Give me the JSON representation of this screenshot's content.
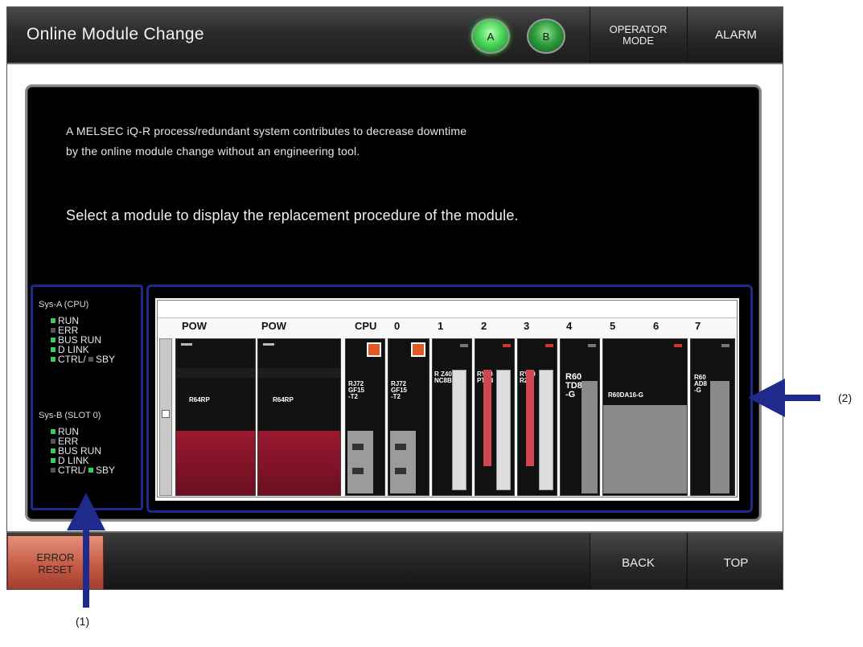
{
  "window": {
    "title": "Online Module Change",
    "lamp_a_label": "A",
    "lamp_b_label": "B",
    "operator_mode_label_line1": "OPERATOR",
    "operator_mode_label_line2": "MODE",
    "alarm_label": "ALARM"
  },
  "panel": {
    "description_line1": "A MELSEC iQ-R process/redundant system contributes to decrease downtime",
    "description_line2": "by the online module change without an engineering tool.",
    "instruction": "Select a module to display the replacement procedure of the module."
  },
  "status": {
    "sys_a": {
      "title": "Sys-A (CPU)",
      "run": "RUN",
      "err": "ERR",
      "bus_run": "BUS RUN",
      "d_link": "D LINK",
      "ctrl": "CTRL/",
      "sby": "SBY"
    },
    "sys_b": {
      "title": "Sys-B (SLOT 0)",
      "run": "RUN",
      "err": "ERR",
      "bus_run": "BUS RUN",
      "d_link": "D LINK",
      "ctrl": "CTRL/",
      "sby": "SBY"
    }
  },
  "rack": {
    "slot_labels": [
      "POW",
      "POW",
      "CPU",
      "0",
      "1",
      "2",
      "3",
      "4",
      "5",
      "6",
      "7"
    ],
    "modules": [
      {
        "name": "R64RP"
      },
      {
        "name": "R64RP"
      },
      {
        "name": "RJ72\nGF15\n-T2"
      },
      {
        "name": "RJ72\nGF15\n-T2"
      },
      {
        "name": "R Z40\nNC8B"
      },
      {
        "name": "RY40\nPT5B"
      },
      {
        "name": "RY10\nR2"
      },
      {
        "name": "R60\nTD8\n-G"
      },
      {
        "name": "R60DA16-G"
      },
      {
        "name": "R60\nAD8\n-G"
      }
    ]
  },
  "bottom": {
    "error_reset_line1": "ERROR",
    "error_reset_line2": "RESET",
    "back_label": "BACK",
    "top_label": "TOP"
  },
  "callouts": {
    "label_1": "(1)",
    "label_2": "(2)"
  },
  "colors": {
    "accent_blue": "#1e2a8c",
    "led_on": "#32d25a",
    "error_button": "#c45a45"
  }
}
